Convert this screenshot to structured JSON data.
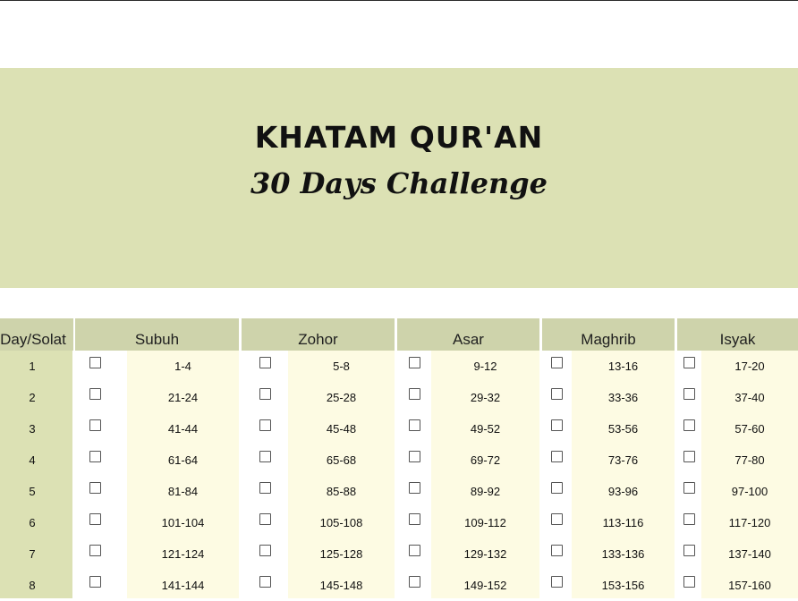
{
  "banner": {
    "title": "KHATAM QUR'AN",
    "subtitle": "30 Days Challenge"
  },
  "table": {
    "day_header": "Day/Solat",
    "prayers": [
      "Subuh",
      "Zohor",
      "Asar",
      "Maghrib",
      "Isyak"
    ],
    "rows": [
      {
        "day": "1",
        "pages": [
          "1-4",
          "5-8",
          "9-12",
          "13-16",
          "17-20"
        ]
      },
      {
        "day": "2",
        "pages": [
          "21-24",
          "25-28",
          "29-32",
          "33-36",
          "37-40"
        ]
      },
      {
        "day": "3",
        "pages": [
          "41-44",
          "45-48",
          "49-52",
          "53-56",
          "57-60"
        ]
      },
      {
        "day": "4",
        "pages": [
          "61-64",
          "65-68",
          "69-72",
          "73-76",
          "77-80"
        ]
      },
      {
        "day": "5",
        "pages": [
          "81-84",
          "85-88",
          "89-92",
          "93-96",
          "97-100"
        ]
      },
      {
        "day": "6",
        "pages": [
          "101-104",
          "105-108",
          "109-112",
          "113-116",
          "117-120"
        ]
      },
      {
        "day": "7",
        "pages": [
          "121-124",
          "125-128",
          "129-132",
          "133-136",
          "137-140"
        ]
      },
      {
        "day": "8",
        "pages": [
          "141-144",
          "145-148",
          "149-152",
          "153-156",
          "157-160"
        ]
      }
    ]
  },
  "colors": {
    "banner_bg": "#dce1b4",
    "header_bg": "#ced3ab",
    "day_column_bg": "#dce1b4",
    "page_column_bg": "#fdfbe3",
    "checkbox_column_bg": "#ffffff"
  }
}
